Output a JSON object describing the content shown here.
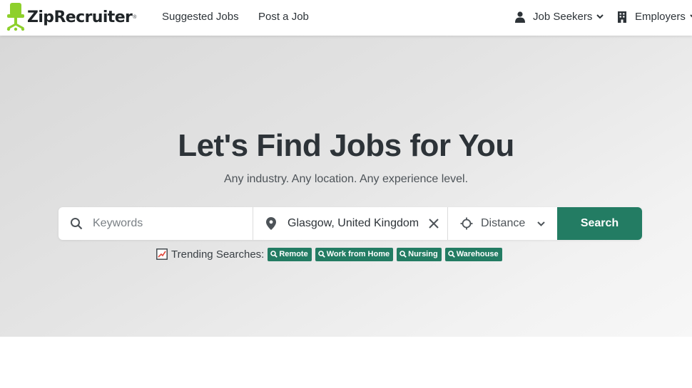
{
  "header": {
    "logo_text": "ZipRecruiter",
    "logo_reg": "®",
    "nav": {
      "suggested_jobs": "Suggested Jobs",
      "post_a_job": "Post a Job",
      "job_seekers": "Job Seekers",
      "employers": "Employers"
    }
  },
  "hero": {
    "title": "Let's Find Jobs for You",
    "subtitle": "Any industry. Any location. Any experience level."
  },
  "search": {
    "keywords_placeholder": "Keywords",
    "keywords_value": "",
    "location_value": "Glasgow, United Kingdom",
    "distance_label": "Distance",
    "button_label": "Search"
  },
  "trending": {
    "label": "Trending Searches:",
    "items": [
      "Remote",
      "Work from Home",
      "Nursing",
      "Warehouse"
    ]
  },
  "colors": {
    "brand_green": "#237c63",
    "logo_green": "#8ed02c",
    "text_dark": "#2d3338"
  },
  "icons": [
    "chair-logo-icon",
    "person-icon",
    "building-icon",
    "chevron-down-icon",
    "search-icon",
    "map-pin-icon",
    "clear-x-icon",
    "crosshair-icon",
    "trending-chart-icon"
  ]
}
